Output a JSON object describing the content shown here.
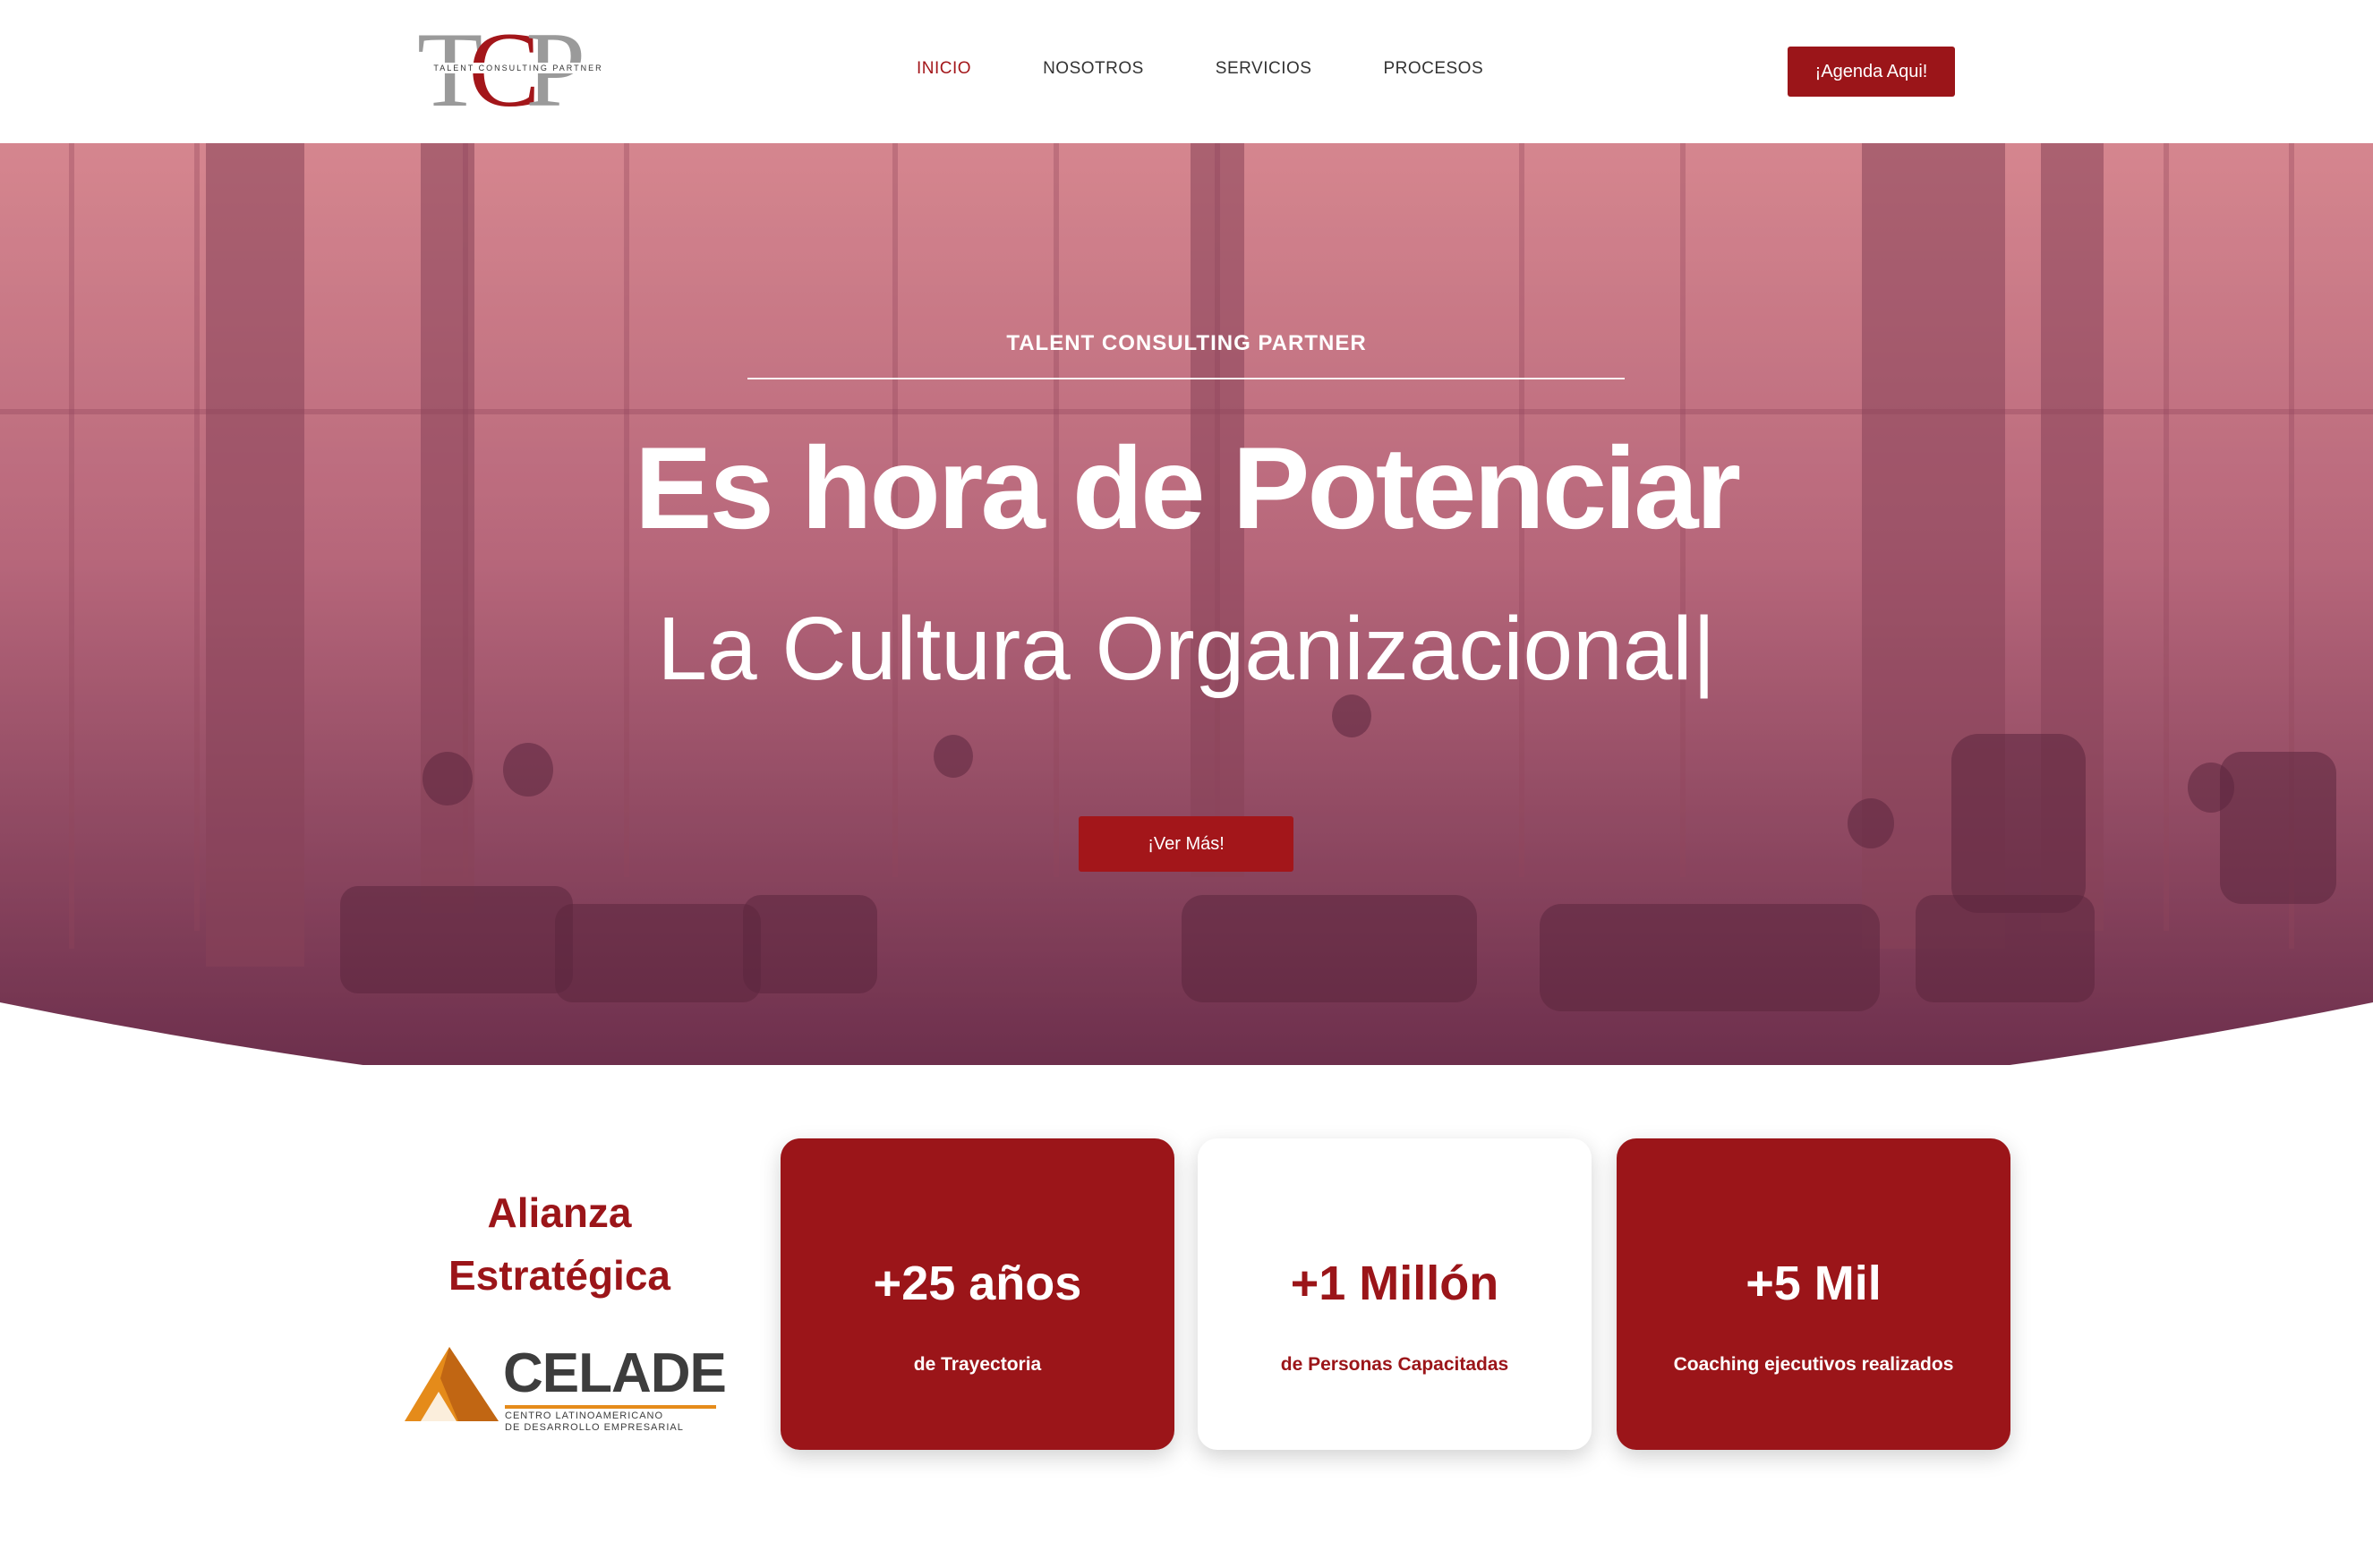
{
  "header": {
    "logo_letters": "TCP",
    "logo_tagline": "TALENT CONSULTING PARTNER",
    "nav": [
      "INICIO",
      "NOSOTROS",
      "SERVICIOS",
      "PROCESOS"
    ],
    "active_nav": "INICIO",
    "cta": "¡Agenda Aqui!"
  },
  "hero": {
    "kicker": "TALENT CONSULTING PARTNER",
    "title": "Es hora de Potenciar",
    "subtitle": "La Cultura Organizacional|",
    "button": "¡Ver Más!"
  },
  "alliance": {
    "line1": "Alianza",
    "line2": "Estratégica",
    "partner_name": "CELADE",
    "partner_desc_1": "CENTRO LATINOAMERICANO",
    "partner_desc_2": "DE DESARROLLO EMPRESARIAL"
  },
  "stats": [
    {
      "value": "+25 años",
      "label": "de Trayectoria",
      "style": "red"
    },
    {
      "value": "+1 Millón",
      "label": "de Personas Capacitadas",
      "style": "white"
    },
    {
      "value": "+5 Mil",
      "label": "Coaching ejecutivos realizados",
      "style": "red"
    }
  ],
  "colors": {
    "brand_red": "#9b1519",
    "hero_overlay_top": "#d98a92",
    "hero_overlay_bottom": "#5e2444",
    "logo_gray": "#9a9a9a",
    "celade_orange": "#e58b1a"
  }
}
